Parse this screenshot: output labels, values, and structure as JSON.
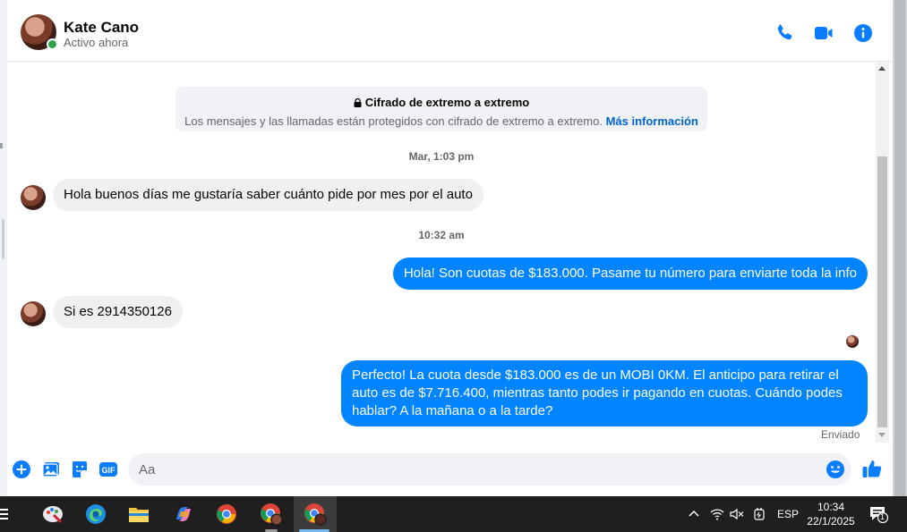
{
  "header": {
    "contact_name": "Kate Cano",
    "contact_status": "Activo ahora"
  },
  "encryption_notice": {
    "title": "Cifrado de extremo a extremo",
    "text": "Los mensajes y las llamadas están protegidos con cifrado de extremo a extremo.",
    "link": "Más información"
  },
  "conversation": {
    "timestamp_1": "Mar, 1:03 pm",
    "message_1": "Hola buenos días me gustaría saber cuánto pide por mes por el auto",
    "timestamp_2": "10:32 am",
    "message_2": "Hola! Son cuotas de $183.000. Pasame tu número para enviarte toda la info",
    "message_3": "Si es 2914350126",
    "message_4": "Perfecto! La cuota desde $183.000 es de un MOBI 0KM. El anticipo para retirar el auto es de $7.716.400, mientras tanto podes ir pagando en cuotas. Cuándo podes hablar? A la mañana o a la tarde?",
    "sent_status": "Enviado"
  },
  "composer": {
    "placeholder": "Aa"
  },
  "taskbar": {
    "language": "ESP",
    "time": "10:34",
    "date": "22/1/2025",
    "notification_count": "1"
  },
  "colors": {
    "accent": "#0084ff",
    "icon_blue": "#0a7cff",
    "incoming_bubble": "#f0f0f0",
    "online": "#31a24c",
    "taskbar": "#1f1f1f"
  }
}
